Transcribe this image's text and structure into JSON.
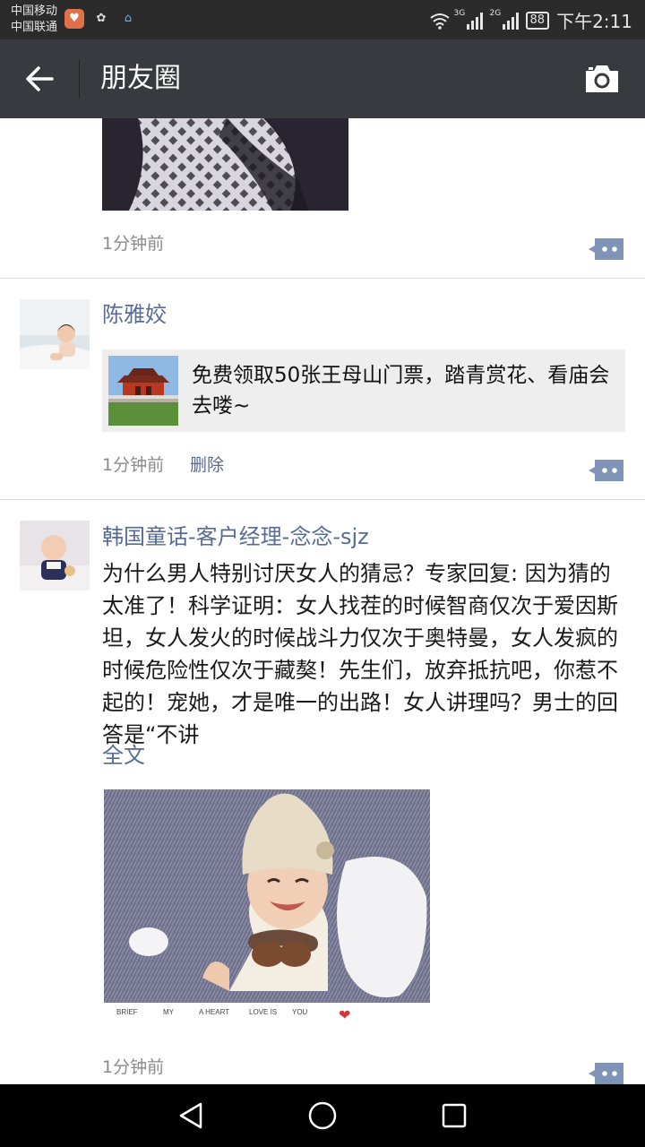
{
  "status_bar": {
    "carrier_1": "中国移动",
    "carrier_2": "中国联通",
    "net_1": "3G",
    "net_2": "2G",
    "battery": "88",
    "time": "下午2:11"
  },
  "header": {
    "title": "朋友圈",
    "back_icon": "arrow-left-icon",
    "camera_icon": "camera-icon"
  },
  "posts": [
    {
      "time": "1分钟前"
    },
    {
      "nickname": "陈雅姣",
      "share_title": "免费领取50张王母山门票，踏青赏花、看庙会去喽~",
      "time": "1分钟前",
      "delete_label": "删除"
    },
    {
      "nickname": "韩国童话-客户经理-念念-sjz",
      "text": "为什么男人特别讨厌女人的猜忌？专家回复: 因为猜的太准了！科学证明：女人找茬的时候智商仅次于爱因斯坦，女人发火的时候战斗力仅次于奥特曼，女人发疯的时候危险性仅次于藏獒！先生们，放弃抵抗吧，你惹不起的！宠她，才是唯一的出路！女人讲理吗？男士的回答是“不讲",
      "full_text_label": "全文",
      "photo_captions": [
        "BRIEF",
        "MY",
        "A HEART",
        "LOVE IS",
        "YOU"
      ],
      "time": "1分钟前"
    }
  ],
  "colors": {
    "link": "#576b95",
    "header_bg": "#393a3f",
    "status_bg": "#2b2b2b"
  }
}
